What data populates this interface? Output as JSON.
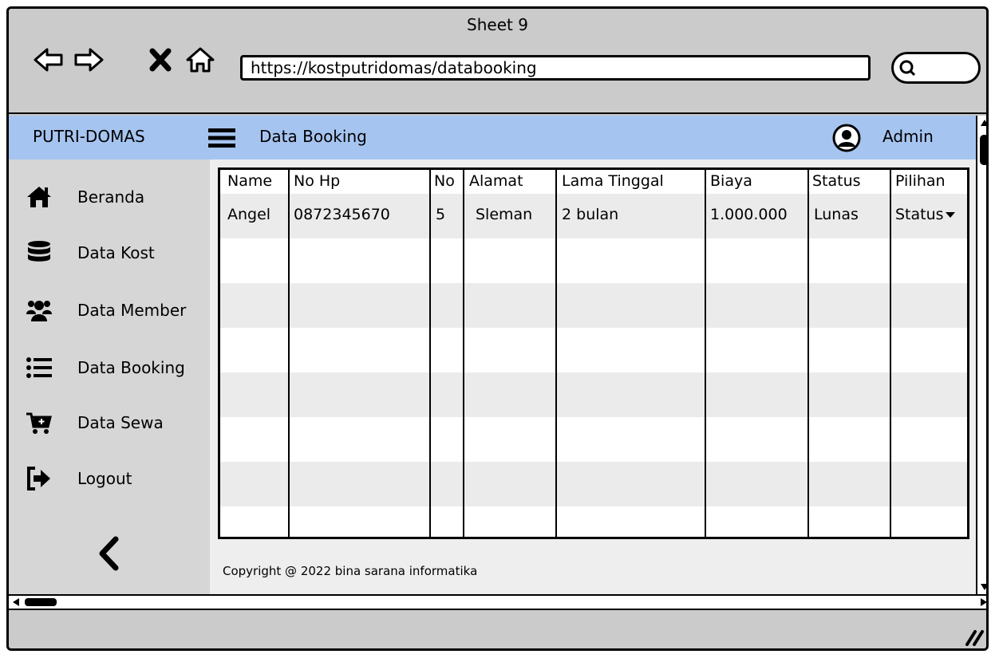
{
  "window": {
    "title": "Sheet 9"
  },
  "browser": {
    "url": "https://kostputridomas/databooking",
    "back_icon": "back-arrow-icon",
    "forward_icon": "forward-arrow-icon",
    "stop_icon": "close-icon",
    "home_icon": "home-icon",
    "search_icon": "search-icon"
  },
  "header": {
    "brand": "PUTRI-DOMAS",
    "title": "Data Booking",
    "user": "Admin",
    "bar_color": "#a6c4f0"
  },
  "sidebar": {
    "items": [
      {
        "label": "Beranda",
        "icon": "home-icon"
      },
      {
        "label": "Data Kost",
        "icon": "database-icon"
      },
      {
        "label": "Data Member",
        "icon": "users-icon"
      },
      {
        "label": "Data Booking",
        "icon": "list-icon"
      },
      {
        "label": "Data Sewa",
        "icon": "cart-icon"
      },
      {
        "label": "Logout",
        "icon": "logout-icon"
      }
    ],
    "collapse_icon": "chevron-left-icon"
  },
  "table": {
    "columns": [
      "Name",
      "No Hp",
      "No",
      "Alamat",
      "Lama Tinggal",
      "Biaya",
      "Status",
      "Pilihan"
    ],
    "rows": [
      {
        "name": "Angel",
        "no_hp": "0872345670",
        "no": "5",
        "alamat": "Sleman",
        "lama_tinggal": "2 bulan",
        "biaya": "1.000.000",
        "status": "Lunas",
        "pilihan": "Status"
      }
    ]
  },
  "footer": {
    "copyright": "Copyright @ 2022 bina sarana informatika"
  }
}
